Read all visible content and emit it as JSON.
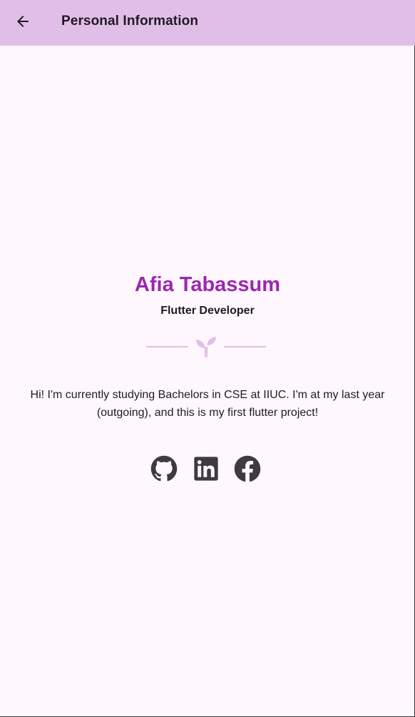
{
  "app_bar": {
    "title": "Personal Information",
    "back_icon": "arrow-back-icon",
    "background": "#e1bee7"
  },
  "profile": {
    "name": "Afia Tabassum",
    "role": "Flutter Developer",
    "divider_icon": "sprout-icon",
    "bio": "Hi! I'm currently studying Bachelors in CSE at IIUC. I'm at my last year (outgoing), and this is my first flutter project!"
  },
  "socials": [
    {
      "icon": "github-icon"
    },
    {
      "icon": "linkedin-icon"
    },
    {
      "icon": "facebook-icon"
    }
  ],
  "colors": {
    "accent": "#9c27b0",
    "text": "#1e1b22",
    "page_background": "#fff7fe",
    "icon": "#3d3a40"
  }
}
